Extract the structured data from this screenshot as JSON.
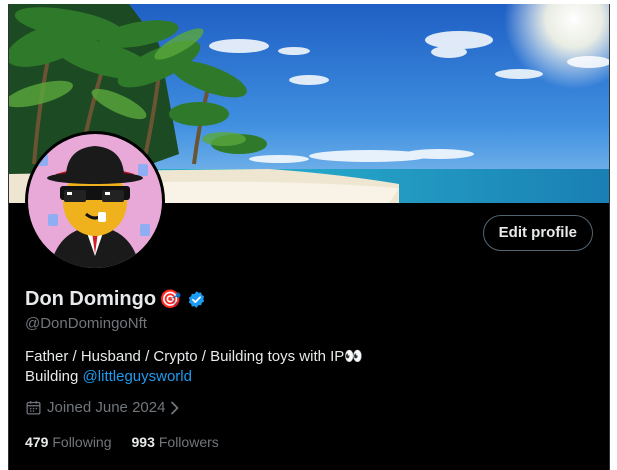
{
  "profile": {
    "display_name": "Don Domingo",
    "name_emoji": "🎯",
    "handle": "@DonDomingoNft",
    "edit_label": "Edit profile",
    "bio_line1": "Father / Husband / Crypto / Building toys with IP👀",
    "bio_line2_prefix": "Building ",
    "bio_link": "@littleguysworld",
    "joined": "Joined June 2024",
    "following_count": "479",
    "following_label": "Following",
    "followers_count": "993",
    "followers_label": "Followers"
  },
  "icons": {
    "verified": "verified-badge-icon",
    "calendar": "calendar-icon",
    "chevron": "chevron-right-icon"
  },
  "colors": {
    "background": "#000000",
    "primary_text": "#e7e9ea",
    "secondary_text": "#71767b",
    "link": "#1d9bf0",
    "verified": "#1d9bf0"
  }
}
